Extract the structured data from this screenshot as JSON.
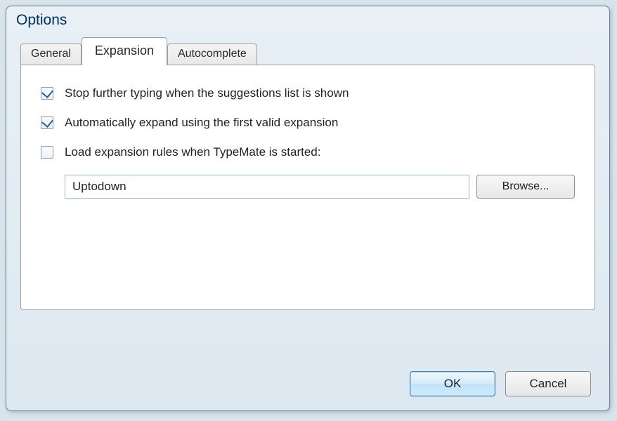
{
  "dialog": {
    "title": "Options"
  },
  "tabs": {
    "general": "General",
    "expansion": "Expansion",
    "autocomplete": "Autocomplete"
  },
  "options": {
    "stop_typing": {
      "label": "Stop further typing when the suggestions list is shown",
      "checked": true
    },
    "auto_expand": {
      "label": "Automatically expand using the first valid expansion",
      "checked": true
    },
    "load_rules": {
      "label": "Load expansion rules when TypeMate is started:",
      "checked": false
    },
    "path_value": "Uptodown",
    "browse_label": "Browse..."
  },
  "buttons": {
    "ok": "OK",
    "cancel": "Cancel"
  }
}
